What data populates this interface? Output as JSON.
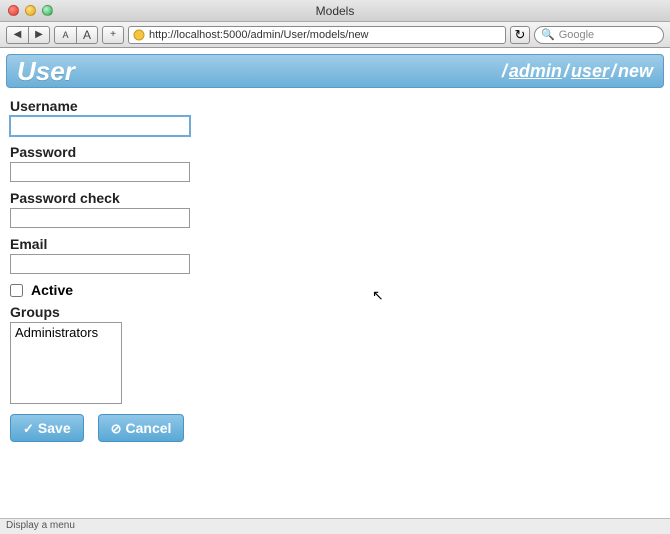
{
  "window": {
    "title": "Models"
  },
  "toolbar": {
    "back": "◀",
    "forward": "▶",
    "text_smaller": "A",
    "text_bigger": "A",
    "add": "+",
    "url": "http://localhost:5000/admin/User/models/new",
    "reload": "↻",
    "search_placeholder": "Google"
  },
  "header": {
    "title": "User",
    "breadcrumb": {
      "sep": "/",
      "seg1": "admin",
      "seg2": "user",
      "seg3": "new"
    }
  },
  "form": {
    "username_label": "Username",
    "username_value": "",
    "password_label": "Password",
    "password_value": "",
    "password_check_label": "Password check",
    "password_check_value": "",
    "email_label": "Email",
    "email_value": "",
    "active_label": "Active",
    "active_checked": false,
    "groups_label": "Groups",
    "groups_options": [
      "Administrators"
    ]
  },
  "buttons": {
    "save_icon": "✓",
    "save_label": "Save",
    "cancel_icon": "⊘",
    "cancel_label": "Cancel"
  },
  "status": {
    "text": "Display a menu"
  }
}
